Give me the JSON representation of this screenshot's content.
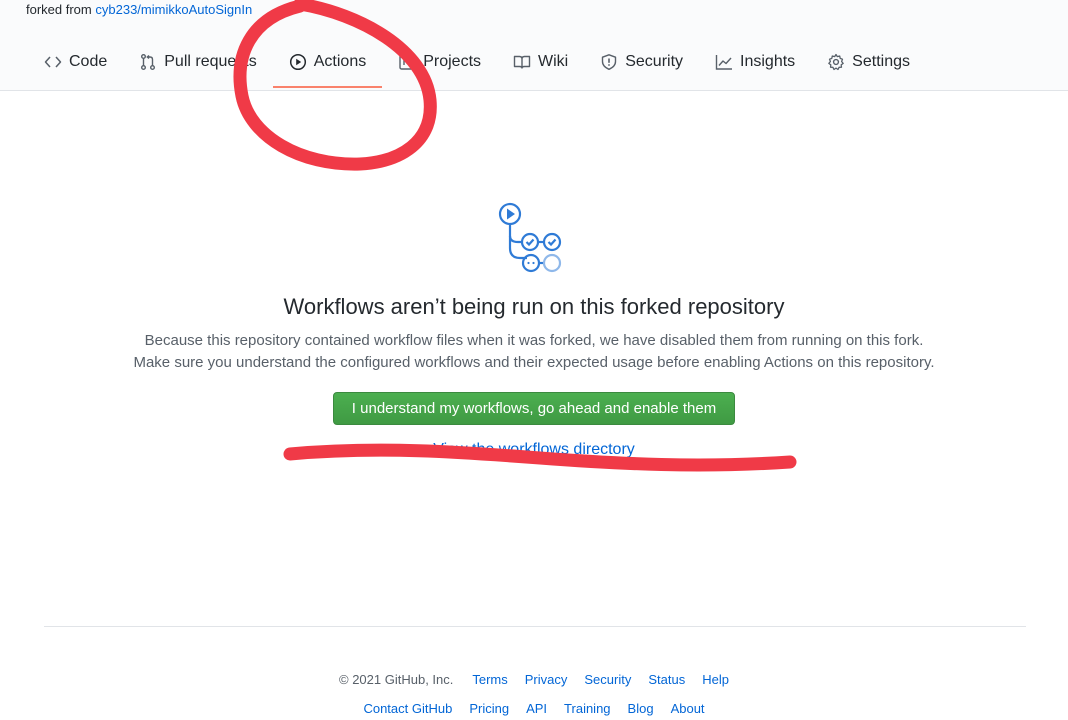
{
  "repo": {
    "forked_prefix": "forked from",
    "forked_link": "cyb233/mimikkoAutoSignIn"
  },
  "nav": {
    "tabs": [
      {
        "label": "Code",
        "icon": "code-icon"
      },
      {
        "label": "Pull requests",
        "icon": "pull-request-icon"
      },
      {
        "label": "Actions",
        "icon": "play-icon",
        "selected": true
      },
      {
        "label": "Projects",
        "icon": "project-icon"
      },
      {
        "label": "Wiki",
        "icon": "book-icon"
      },
      {
        "label": "Security",
        "icon": "shield-icon"
      },
      {
        "label": "Insights",
        "icon": "graph-icon"
      },
      {
        "label": "Settings",
        "icon": "gear-icon"
      }
    ],
    "selected_underline_color": "#f9826c"
  },
  "main": {
    "icon": "workflow-icon",
    "title": "Workflows aren’t being run on this forked repository",
    "description_line1": "Because this repository contained workflow files when it was forked, we have disabled them from running on this fork.",
    "description_line2": "Make sure you understand the configured workflows and their expected usage before enabling Actions on this repository.",
    "enable_button": "I understand my workflows, go ahead and enable them",
    "view_link": "View the workflows directory"
  },
  "footer": {
    "copyright": "© 2021 GitHub, Inc.",
    "row1_links": [
      "Terms",
      "Privacy",
      "Security",
      "Status",
      "Help"
    ],
    "row2_links": [
      "Contact GitHub",
      "Pricing",
      "API",
      "Training",
      "Blog",
      "About"
    ]
  },
  "colors": {
    "link": "#0366d6",
    "button_green": "#43a047",
    "annotation_red": "#f03a47"
  }
}
